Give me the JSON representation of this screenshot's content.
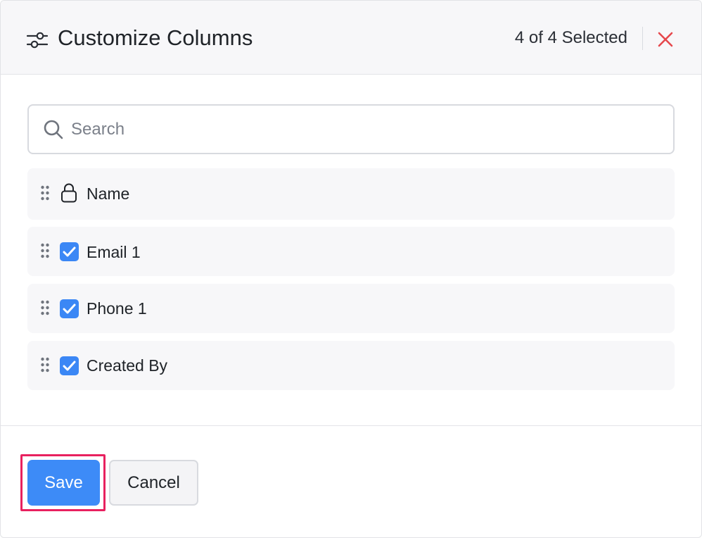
{
  "header": {
    "title": "Customize Columns",
    "selected_count": "4 of 4 Selected",
    "icon": "sliders-icon",
    "close_icon": "close-icon"
  },
  "search": {
    "placeholder": "Search",
    "value": "",
    "icon": "search-icon"
  },
  "columns": [
    {
      "label": "Name",
      "locked": true,
      "checked": true
    },
    {
      "label": "Email 1",
      "locked": false,
      "checked": true
    },
    {
      "label": "Phone 1",
      "locked": false,
      "checked": true
    },
    {
      "label": "Created By",
      "locked": false,
      "checked": true
    }
  ],
  "footer": {
    "save_label": "Save",
    "cancel_label": "Cancel"
  },
  "colors": {
    "accent": "#3d8bf7",
    "close": "#e5484d",
    "highlight": "#e8215f",
    "row_bg": "#f7f7f9"
  }
}
